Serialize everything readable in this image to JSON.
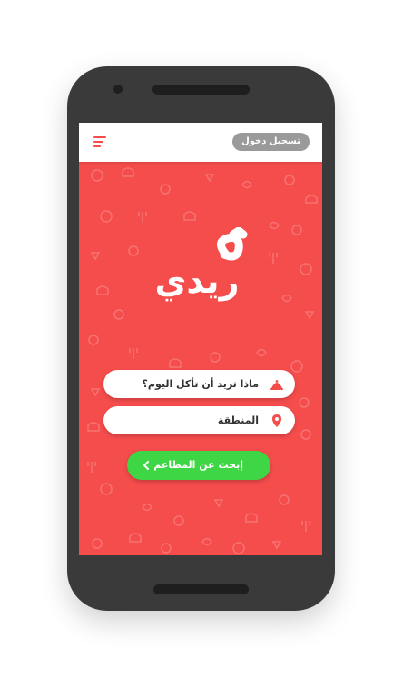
{
  "appbar": {
    "login_label": "تسجيل دخول",
    "menu_icon": "hamburger-menu-icon"
  },
  "logo": {
    "text": "ريدي",
    "alt": "app-logo"
  },
  "search": {
    "food_placeholder": "ماذا تريد أن تأكل اليوم؟",
    "food_icon": "cloche-icon",
    "area_placeholder": "المنطقة",
    "area_icon": "location-pin-icon",
    "submit_label": "إبحث عن المطاعم",
    "submit_icon": "chevron-left-icon"
  },
  "colors": {
    "brand_red": "#f54c4c",
    "button_green": "#3fd645",
    "login_gray": "#9a9a9a",
    "phone_body": "#3a3a3a"
  }
}
